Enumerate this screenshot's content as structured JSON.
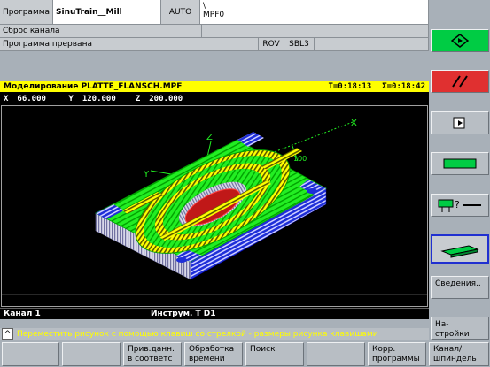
{
  "header": {
    "program_label": "Программа",
    "machine": "SinuTrain__Mill",
    "mode": "AUTO",
    "path_top": "\\",
    "path_bottom": "MPF0"
  },
  "status": {
    "channel_reset": "Сброс канала",
    "program_status": "Программа прервана",
    "rov": "ROV",
    "sbl": "SBL3"
  },
  "simulation": {
    "title": "Моделирование  PLATTE_FLANSCH.MPF",
    "time_t": "T=0:18:13",
    "time_sigma": "Σ=0:18:42",
    "x_label": "X",
    "x_value": "66.000",
    "y_label": "Y",
    "y_value": "120.000",
    "z_label": "Z",
    "z_value": "200.000",
    "axis_x": "X",
    "axis_y": "Y",
    "axis_z": "Z",
    "scale": "100",
    "channel": "Канал 1",
    "tool": "Инструм. T  D1"
  },
  "hint": {
    "icon": "^",
    "text": "Переместить рисунок с помощью клавиш со стрелкой - размеры рисунка клавишами"
  },
  "softkeys_right": {
    "info": "Сведения..",
    "settings": "На-\nстройки"
  },
  "softkeys_bottom": [
    "",
    "",
    "Прив.данн.\nв соответс",
    "Обработка\nвремени",
    "Поиск",
    "",
    "Корр.\nпрограммы",
    "Канал/\nшпиндель"
  ],
  "colors": {
    "background": "#a8b0b8",
    "title_bar": "#ffff00",
    "sim_background": "#000000",
    "start_button": "#00cc44",
    "reset_button": "#e03030",
    "hint_bar": "#ffff00"
  },
  "icons": [
    "cycle-start-icon",
    "reset-icon",
    "jump-icon",
    "block-icon",
    "tool-check-icon",
    "3d-view-icon",
    "up-arrow-icon"
  ]
}
